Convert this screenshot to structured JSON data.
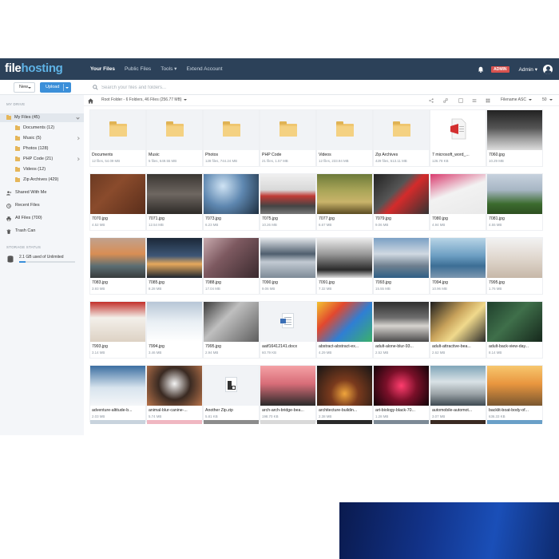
{
  "brand": {
    "name_a": "file",
    "name_b": "hosting"
  },
  "nav": {
    "links": [
      "Your Files",
      "Public Files",
      "Tools ▾",
      "Extend Account"
    ],
    "admin_badge": "ADMIN",
    "admin_menu": "Admin ▾"
  },
  "toolbar": {
    "new_label": "New",
    "upload_label": "Upload",
    "search_placeholder": "Search your files and folders..."
  },
  "sidebar": {
    "section_my_drive": "MY DRIVE",
    "items": [
      {
        "label": "My Files (45)"
      },
      {
        "label": "Documents (12)"
      },
      {
        "label": "Music (5)"
      },
      {
        "label": "Photos (128)"
      },
      {
        "label": "PHP Code (21)"
      },
      {
        "label": "Videos (12)"
      },
      {
        "label": "Zip Archives (429)"
      },
      {
        "label": "Shared With Me"
      },
      {
        "label": "Recent Files"
      },
      {
        "label": "All Files (700)"
      },
      {
        "label": "Trash Can"
      }
    ],
    "section_storage": "STORAGE STATUS",
    "storage_text": "2.1 GB used of Unlimited",
    "storage_fraction": 0.12
  },
  "pathbar": {
    "path": "Root Folder - 6 Folders, 46 Files (256.77 MB)",
    "sort": "Filename ASC",
    "per_page": "50"
  },
  "tiles": [
    {
      "name": "Documents",
      "meta": "12 files, 54.09 MB"
    },
    {
      "name": "Music",
      "meta": "5 files, 649.55 MB"
    },
    {
      "name": "Photos",
      "meta": "128 files, 744.24 MB"
    },
    {
      "name": "PHP Code",
      "meta": "21 files, 1.57 MB"
    },
    {
      "name": "Videos",
      "meta": "12 files, 233.94 MB"
    },
    {
      "name": "Zip Archives",
      "meta": "429 files, 513.11 MB"
    },
    {
      "name": "7 microsoft_word_...",
      "meta": "126.78 KB"
    },
    {
      "name": "7060.jpg",
      "meta": "10.29 MB"
    },
    {
      "name": "7070.jpg",
      "meta": "4.52 MB"
    },
    {
      "name": "7071.jpg",
      "meta": "12.54 MB"
    },
    {
      "name": "7073.jpg",
      "meta": "6.23 MB"
    },
    {
      "name": "7075.jpg",
      "meta": "10.26 MB"
    },
    {
      "name": "7077.jpg",
      "meta": "6.67 MB"
    },
    {
      "name": "7079.jpg",
      "meta": "9.06 MB"
    },
    {
      "name": "7080.jpg",
      "meta": "4.94 MB"
    },
    {
      "name": "7081.jpg",
      "meta": "4.55 MB"
    },
    {
      "name": "7083.jpg",
      "meta": "3.93 MB"
    },
    {
      "name": "7085.jpg",
      "meta": "8.28 MB"
    },
    {
      "name": "7088.jpg",
      "meta": "17.04 MB"
    },
    {
      "name": "7090.jpg",
      "meta": "9.06 MB"
    },
    {
      "name": "7091.jpg",
      "meta": "7.32 MB"
    },
    {
      "name": "7093.jpg",
      "meta": "15.55 MB"
    },
    {
      "name": "7094.jpg",
      "meta": "10.96 MB"
    },
    {
      "name": "7995.jpg",
      "meta": "1.76 MB"
    },
    {
      "name": "7993.jpg",
      "meta": "3.14 MB"
    },
    {
      "name": "7994.jpg",
      "meta": "3.46 MB"
    },
    {
      "name": "7995.jpg",
      "meta": "2.94 MB"
    },
    {
      "name": "aatf16412141.docx",
      "meta": "60.79 KB"
    },
    {
      "name": "abstract-abstract-ex...",
      "meta": "4.29 MB"
    },
    {
      "name": "adult-alone-blur-93...",
      "meta": "2.52 MB"
    },
    {
      "name": "adult-attractive-bea...",
      "meta": "2.62 MB"
    },
    {
      "name": "adult-back-view-day...",
      "meta": "8.14 MB"
    },
    {
      "name": "adventure-altitude-b...",
      "meta": "2.03 MB"
    },
    {
      "name": "animal-blur-canine-...",
      "meta": "5.74 MB"
    },
    {
      "name": "Another Zip.zip",
      "meta": "5.81 KB"
    },
    {
      "name": "arch-arch-bridge-bea...",
      "meta": "198.70 KB"
    },
    {
      "name": "architecture-buildin...",
      "meta": "2.38 MB"
    },
    {
      "name": "art-biology-black-70...",
      "meta": "1.28 MB"
    },
    {
      "name": "automobile-automot...",
      "meta": "3.07 MB"
    },
    {
      "name": "backlit-boat-body-of...",
      "meta": "636.33 KB"
    }
  ]
}
